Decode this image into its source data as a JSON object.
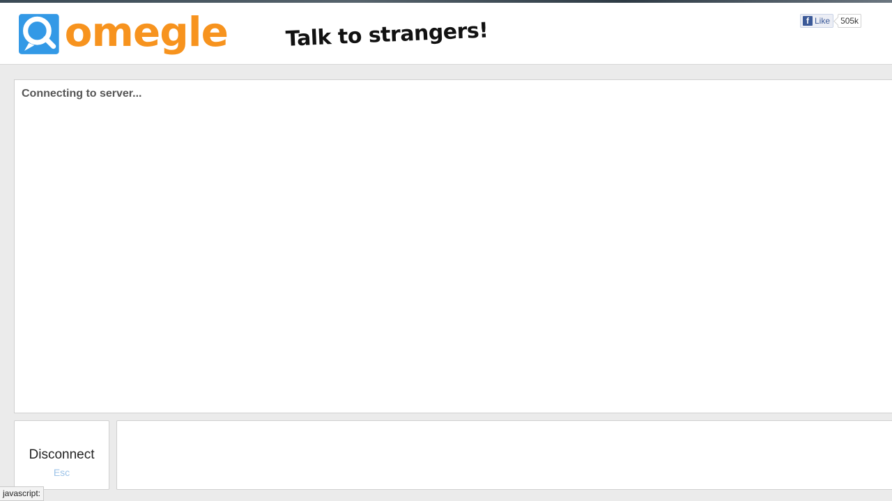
{
  "header": {
    "logo_text": "omegle",
    "tagline": "Talk to strangers!",
    "facebook": {
      "like_label": "Like",
      "like_count": "505k"
    }
  },
  "chat": {
    "status_message": "Connecting to server..."
  },
  "controls": {
    "disconnect_label": "Disconnect",
    "disconnect_shortcut": "Esc",
    "message_placeholder": ""
  },
  "status_bar": {
    "text": "javascript:"
  },
  "colors": {
    "brand_orange": "#f7931e",
    "brand_blue": "#3399e6",
    "facebook_blue": "#3b5998",
    "shortcut_blue": "#9cc3e8"
  },
  "icons": {
    "logo": "omegle-chat-bubble-icon",
    "facebook": "facebook-f-icon"
  }
}
